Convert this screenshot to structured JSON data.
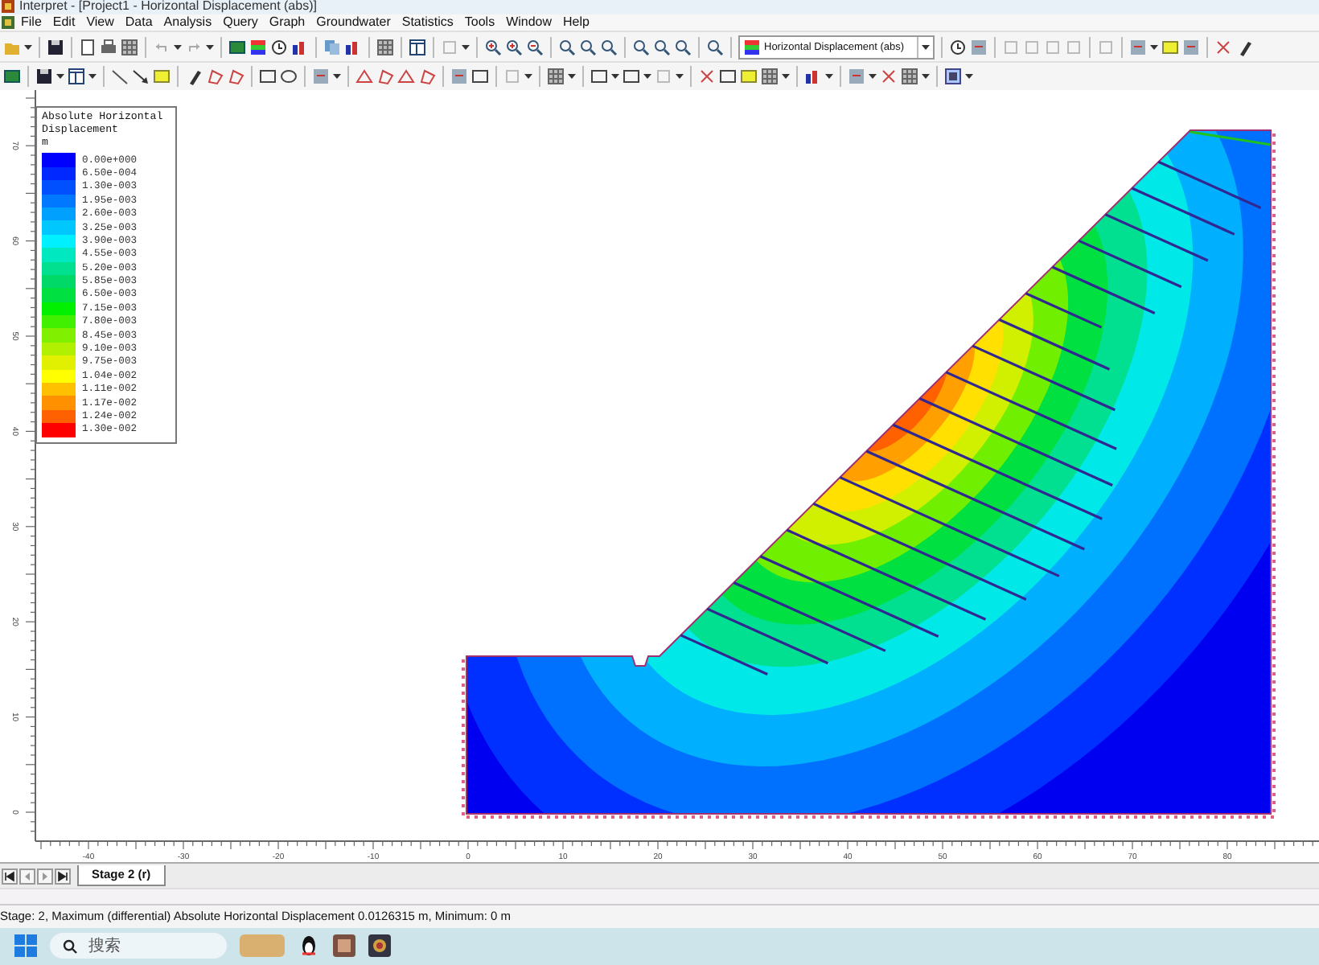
{
  "window": {
    "title": "Interpret - [Project1 - Horizontal Displacement (abs)]"
  },
  "menu": [
    "File",
    "Edit",
    "View",
    "Data",
    "Analysis",
    "Query",
    "Graph",
    "Groundwater",
    "Statistics",
    "Tools",
    "Window",
    "Help"
  ],
  "toolbar": {
    "result_dropdown": "Horizontal Displacement (abs)"
  },
  "plot": {
    "x_ticks": [
      "-40",
      "-30",
      "-20",
      "-10",
      "0",
      "10",
      "20",
      "30",
      "40",
      "50",
      "60",
      "70",
      "80"
    ],
    "y_ticks": [
      "70",
      "60",
      "50",
      "40",
      "30",
      "20",
      "10",
      "0"
    ]
  },
  "legend": {
    "title": "Absolute Horizontal Displacement",
    "unit": "m",
    "entries": [
      {
        "label": "0.00e+000",
        "color": "#0000ff"
      },
      {
        "label": "6.50e-004",
        "color": "#0028ff"
      },
      {
        "label": "1.30e-003",
        "color": "#0050ff"
      },
      {
        "label": "1.95e-003",
        "color": "#0078ff"
      },
      {
        "label": "2.60e-003",
        "color": "#00a0ff"
      },
      {
        "label": "3.25e-003",
        "color": "#00c8ff"
      },
      {
        "label": "3.90e-003",
        "color": "#00f0ff"
      },
      {
        "label": "4.55e-003",
        "color": "#00e8c0"
      },
      {
        "label": "5.20e-003",
        "color": "#00e090"
      },
      {
        "label": "5.85e-003",
        "color": "#00d868"
      },
      {
        "label": "6.50e-003",
        "color": "#00e040"
      },
      {
        "label": "7.15e-003",
        "color": "#00f000"
      },
      {
        "label": "7.80e-003",
        "color": "#40f000"
      },
      {
        "label": "8.45e-003",
        "color": "#80f000"
      },
      {
        "label": "9.10e-003",
        "color": "#b0f000"
      },
      {
        "label": "9.75e-003",
        "color": "#e0f000"
      },
      {
        "label": "1.04e-002",
        "color": "#ffff00"
      },
      {
        "label": "1.11e-002",
        "color": "#ffc000"
      },
      {
        "label": "1.17e-002",
        "color": "#ff9000"
      },
      {
        "label": "1.24e-002",
        "color": "#ff6000"
      },
      {
        "label": "1.30e-002",
        "color": "#ff0000"
      }
    ]
  },
  "stage_tabs": [
    {
      "label": "Stage 2 (r)",
      "selected": true
    }
  ],
  "status_bar": "Stage: 2, Maximum (differential) Absolute Horizontal Displacement 0.0126315 m, Minimum:  0 m",
  "taskbar": {
    "search": {
      "placeholder": "搜索"
    }
  }
}
